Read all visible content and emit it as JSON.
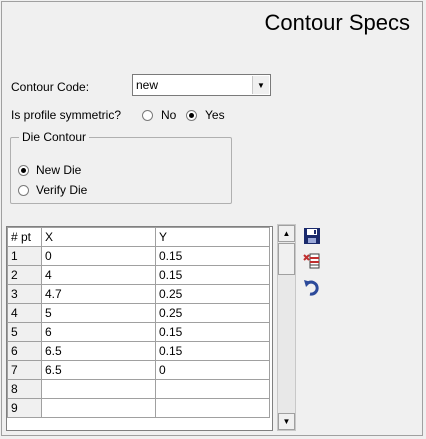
{
  "header": {
    "title": "Contour Specs"
  },
  "form": {
    "contour_code_label": "Contour Code:",
    "contour_code_value": "new",
    "symmetric_label": "Is profile symmetric?",
    "symmetric_options": {
      "no": "No",
      "yes": "Yes"
    },
    "symmetric_selected": "Yes"
  },
  "die_group": {
    "title": "Die Contour",
    "options": {
      "new_die": "New Die",
      "verify_die": "Verify Die"
    },
    "selected": "New Die"
  },
  "grid": {
    "headers": [
      "# pt",
      "X",
      "Y"
    ],
    "rows": [
      [
        "1",
        "0",
        "0.15"
      ],
      [
        "2",
        "4",
        "0.15"
      ],
      [
        "3",
        "4.7",
        "0.25"
      ],
      [
        "4",
        "5",
        "0.25"
      ],
      [
        "5",
        "6",
        "0.15"
      ],
      [
        "6",
        "6.5",
        "0.15"
      ],
      [
        "7",
        "6.5",
        "0"
      ],
      [
        "8",
        "",
        ""
      ],
      [
        "9",
        "",
        ""
      ]
    ]
  },
  "toolbar": {
    "icons": [
      "save-icon",
      "delete-rows-icon",
      "undo-icon"
    ],
    "colors": {
      "save": "#1a2a6c",
      "delete": "#c03030",
      "undo": "#2c4a9a"
    }
  }
}
